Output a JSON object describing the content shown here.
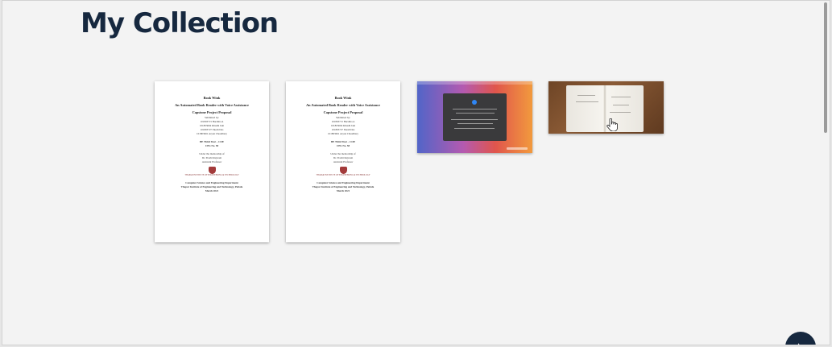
{
  "page": {
    "title": "My Collection"
  },
  "documents": [
    {
      "title": "Book Wink",
      "subtitle": "An Automated Book Reader with Voice Assistance",
      "heading": "Capstone Project Proposal",
      "submitted_by_label": "Submitted by:",
      "members": [
        "101803715 Harshita A",
        "101803694 Khushi Jain",
        "101803727 Ekesh Das",
        "101803661 Aryan Choudhary"
      ],
      "batch": "BE Third Year – COE",
      "cpg": "CPG No. 58",
      "mentorship_label": "Under the mentorship of",
      "mentor": "Dr. Prashi Rajwani",
      "mentor_title": "Assistant Professor",
      "logo_text": "THAPAR INSTITUTE OF ENGINEERING & TECHNOLOGY",
      "department": "Computer Science and Engineering Department",
      "institute": "Thapar Institute of Engineering and Technology, Patiala",
      "date": "March 2021"
    },
    {
      "title": "Book Wink",
      "subtitle": "An Automated Book Reader with Voice Assistance",
      "heading": "Capstone Project Proposal",
      "submitted_by_label": "Submitted by:",
      "members": [
        "101803715 Harshita A",
        "101803694 Khushi Jain",
        "101803727 Ekesh Das",
        "101803661 Aryan Choudhary"
      ],
      "batch": "BE Third Year – COE",
      "cpg": "CPG No. 58",
      "mentorship_label": "Under the mentorship of",
      "mentor": "Dr. Prashi Rajwani",
      "mentor_title": "Assistant Professor",
      "logo_text": "THAPAR INSTITUTE OF ENGINEERING & TECHNOLOGY",
      "department": "Computer Science and Engineering Department",
      "institute": "Thapar Institute of Engineering and Technology, Patiala",
      "date": "March 2021"
    }
  ],
  "colors": {
    "title": "#16283f",
    "background": "#f3f3f3",
    "fab": "#16283f"
  },
  "icons": {
    "fab": "arrow-up-icon",
    "cursor": "hand-pointer-icon"
  }
}
